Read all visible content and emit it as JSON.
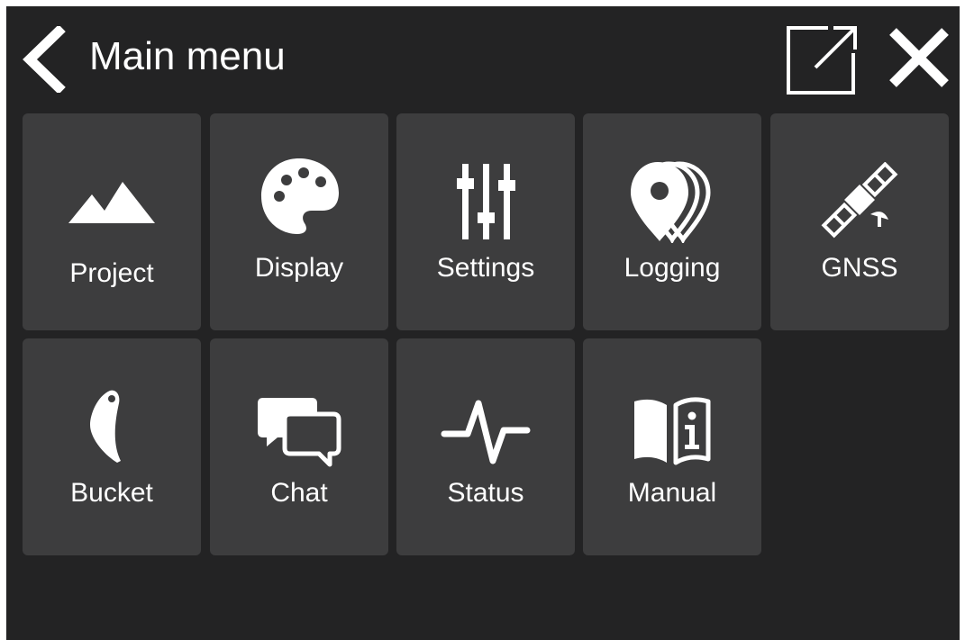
{
  "header": {
    "title": "Main menu",
    "back_icon": "chevron-left-icon",
    "popout_icon": "external-window-icon",
    "close_icon": "close-icon"
  },
  "tiles": [
    {
      "label": "Project",
      "icon": "mountains-icon"
    },
    {
      "label": "Display",
      "icon": "palette-icon"
    },
    {
      "label": "Settings",
      "icon": "sliders-icon"
    },
    {
      "label": "Logging",
      "icon": "location-pins-icon"
    },
    {
      "label": "GNSS",
      "icon": "satellite-icon"
    },
    {
      "label": "Bucket",
      "icon": "bucket-icon"
    },
    {
      "label": "Chat",
      "icon": "chat-bubbles-icon"
    },
    {
      "label": "Status",
      "icon": "pulse-icon"
    },
    {
      "label": "Manual",
      "icon": "info-book-icon"
    }
  ],
  "colors": {
    "background": "#232324",
    "tile": "#3d3d3e",
    "foreground": "#ffffff"
  }
}
